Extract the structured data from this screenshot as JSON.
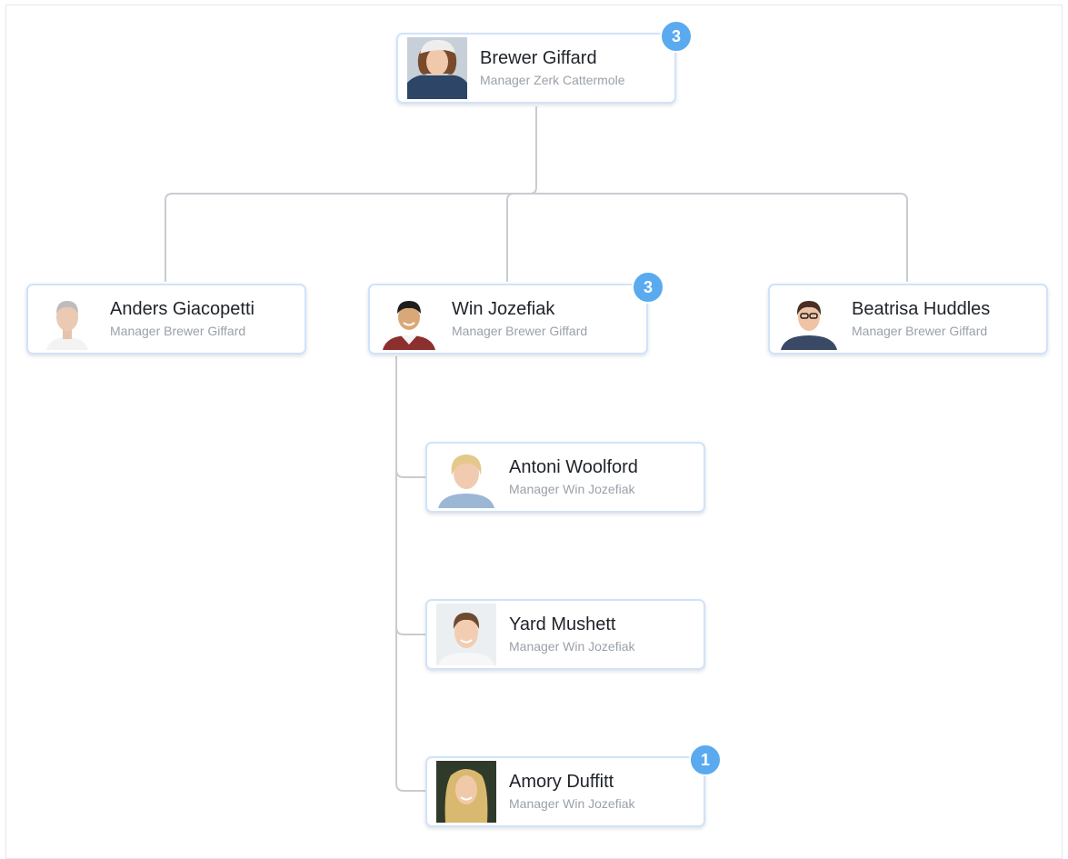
{
  "accent_color": "#5aaaf0",
  "node_border_color": "#cfe3fb",
  "connector_color": "#c9ccd1",
  "root": {
    "name": "Brewer Giffard",
    "role": "Manager Zerk Cattermole",
    "badge": "3"
  },
  "level2": [
    {
      "name": "Anders Giacopetti",
      "role": "Manager Brewer Giffard"
    },
    {
      "name": "Win Jozefiak",
      "role": "Manager Brewer Giffard",
      "badge": "3"
    },
    {
      "name": "Beatrisa Huddles",
      "role": "Manager Brewer Giffard"
    }
  ],
  "reports": [
    {
      "name": "Antoni Woolford",
      "role": "Manager Win Jozefiak"
    },
    {
      "name": "Yard Mushett",
      "role": "Manager Win Jozefiak"
    },
    {
      "name": "Amory Duffitt",
      "role": "Manager Win Jozefiak",
      "badge": "1"
    }
  ]
}
